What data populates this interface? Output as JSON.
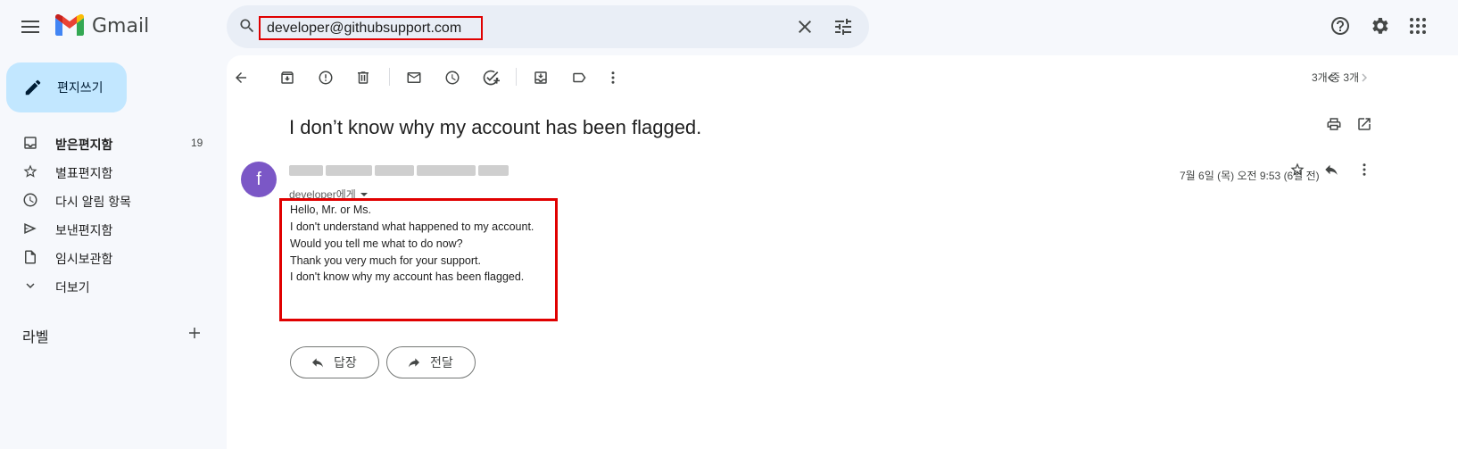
{
  "app": {
    "brand": "Gmail",
    "icons": {
      "menu": "hamburger-menu-icon",
      "logo": "gmail-logo-icon",
      "help": "help-icon",
      "settings": "gear-icon",
      "apps": "apps-grid-icon"
    }
  },
  "search": {
    "value": "developer@githubsupport.com",
    "placeholder": "",
    "highlight_color": "#e00000"
  },
  "sidebar": {
    "compose_label": "편지쓰기",
    "items": [
      {
        "label": "받은편지함",
        "count": "19",
        "icon": "inbox-icon"
      },
      {
        "label": "별표편지함",
        "icon": "star-icon"
      },
      {
        "label": "다시 알림 항목",
        "icon": "clock-icon"
      },
      {
        "label": "보낸편지함",
        "icon": "send-icon"
      },
      {
        "label": "임시보관함",
        "icon": "draft-icon"
      },
      {
        "label": "더보기",
        "icon": "chevron-down-icon"
      }
    ],
    "labels_title": "라벨"
  },
  "toolbar": {
    "pager_text": "3개 중 3개"
  },
  "email": {
    "subject": "I don’t know why my account has been flagged.",
    "avatar_letter": "f",
    "avatar_color": "#7b57c6",
    "to": "developer에게",
    "date": "7월 6일 (목) 오전 9:53 (6일 전)",
    "body": [
      "Hello, Mr. or Ms.",
      "I don't understand what happened to my account.",
      "Would you tell me what to do now?",
      "Thank you very much for your support.",
      "I don't know why my account has been flagged."
    ],
    "reply_label": "답장",
    "forward_label": "전달"
  }
}
